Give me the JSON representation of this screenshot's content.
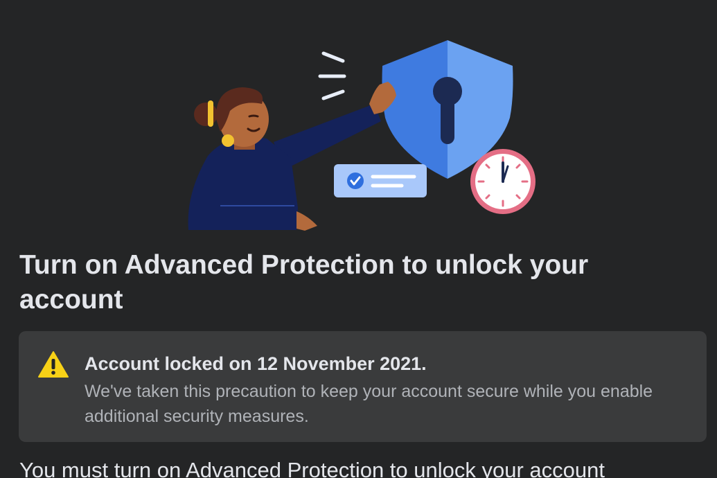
{
  "page": {
    "title": "Turn on Advanced Protection to unlock your account",
    "notice": {
      "heading": "Account locked on 12 November 2021.",
      "body": "We've taken this precaution to keep your account secure while you enable additional security measures."
    },
    "body_text": "You must turn on Advanced Protection to unlock your account"
  },
  "icons": {
    "warning": "warning-triangle-icon",
    "illustration": "security-shield-illustration"
  },
  "colors": {
    "background": "#242526",
    "card": "#3a3b3c",
    "primary_text": "#e4e6eb",
    "secondary_text": "#b0b3b8",
    "warning": "#f7d117",
    "shield_blue": "#4a86e8"
  }
}
